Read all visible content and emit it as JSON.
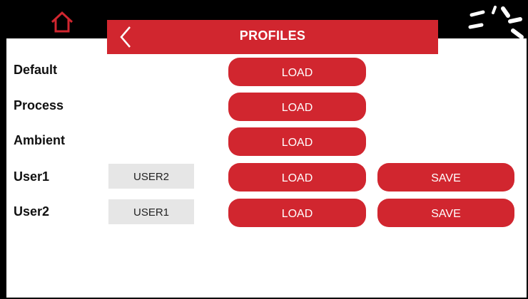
{
  "header": {
    "title": "PROFILES",
    "home_icon": "home-icon",
    "back_icon": "chevron-left-icon",
    "status_icon": "loading-spinner-icon"
  },
  "colors": {
    "accent": "#d1262f",
    "header_bg": "#000000",
    "field_bg": "#e6e6e6"
  },
  "profiles": [
    {
      "label": "Default",
      "load": "LOAD"
    },
    {
      "label": "Process",
      "load": "LOAD"
    },
    {
      "label": "Ambient",
      "load": "LOAD"
    },
    {
      "label": "User1",
      "name_value": "USER2",
      "load": "LOAD",
      "save": "SAVE"
    },
    {
      "label": "User2",
      "name_value": "USER1",
      "load": "LOAD",
      "save": "SAVE"
    }
  ]
}
